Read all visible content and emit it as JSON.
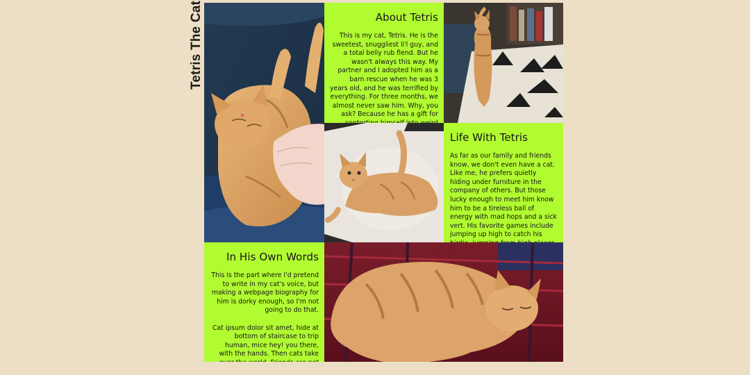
{
  "site_title": "Tetris The Cat",
  "sections": {
    "about": {
      "heading": "About Tetris",
      "body": "This is my cat, Tetris. He is the sweetest, snuggliest li'l guy, and a total belly rub fiend. But he wasn't always this way. My partner and I adopted him as a barn rescue when he was 3 years old, and he was terrified by everything. For three months, we almost never saw him. Why, you ask? Because he has a gift for contorting himself into weird places."
    },
    "life": {
      "heading": "Life With Tetris",
      "body": "As far as our family and friends know, we don't even have a cat. Like me, he prefers quietly hiding under furniture in the company of others. But those lucky enough to meet him know him to be a tireless ball of energy with mad hops and a sick vert. His favorite games include jumping up high to catch his birdie, jumping from high places to catch his birdie, and generally catching his birdie."
    },
    "words": {
      "heading": "In His Own Words",
      "intro": "This is the part where I'd pretend to write in my cat's voice, but making a webpage biography for him is dorky enough, so I'm not going to do that.",
      "body": "Cat ipsum dolor sit amet, hide at bottom of staircase to trip human, mice hey! you there, with the hands. Then cats take over the world. Friends are not food hey! you there, with the hands, lick your arm."
    }
  },
  "photos": {
    "belly_rub": "cat-belly-rub-photo",
    "standing": "cat-standing-photo",
    "looking_up": "cat-looking-up-photo",
    "sleeping": "cat-sleeping-photo"
  },
  "colors": {
    "background": "#ecdfc6",
    "panel": "#b1fb31",
    "text": "#151515"
  }
}
